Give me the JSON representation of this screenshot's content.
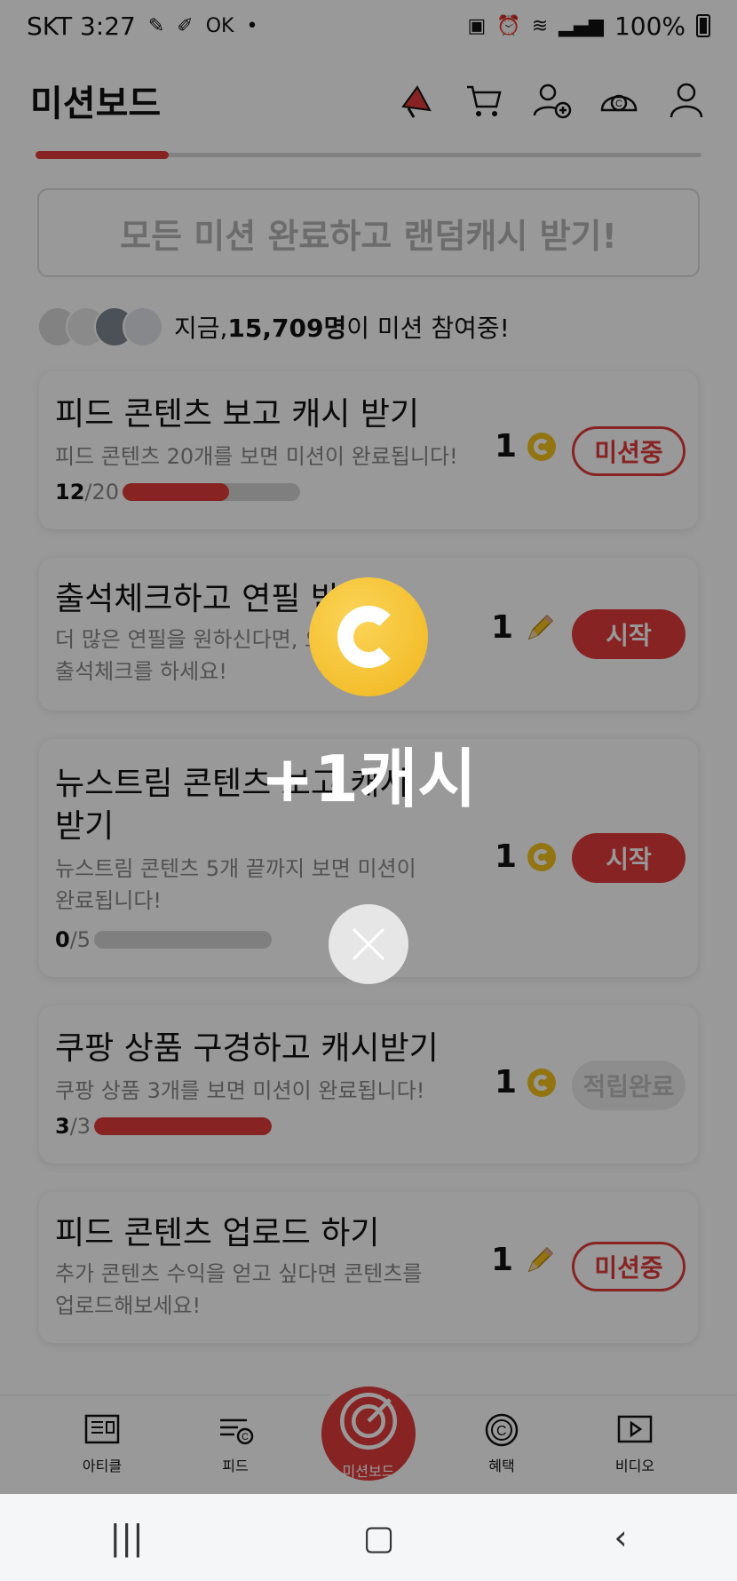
{
  "status_bar": {
    "carrier_time": "SKT 3:27",
    "ok_badge": "OK",
    "dot": "•",
    "battery_text": "100%"
  },
  "header": {
    "title": "미션보드"
  },
  "banner": {
    "text": "모든 미션 완료하고 랜덤캐시 받기!"
  },
  "participants": {
    "prefix": "지금, ",
    "count": "15,709명",
    "suffix": "이 미션 참여중!"
  },
  "missions": [
    {
      "title": "피드 콘텐츠 보고 캐시 받기",
      "desc_lines": [
        "피드 콘텐츠 20개를 보면 미션이 완료됩니다!"
      ],
      "progress_current": "12",
      "progress_total": "/20",
      "progress_fraction": 0.6,
      "reward": "1",
      "reward_icon": "coin-icon",
      "button": "미션중",
      "button_style": "outline"
    },
    {
      "title": "출석체크하고 연필 받기",
      "desc_lines": [
        "더 많은 연필을 원하신다면, 오늘도",
        "출석체크를 하세요!"
      ],
      "reward": "1",
      "reward_icon": "pencil-icon",
      "button": "시작",
      "button_style": "solid"
    },
    {
      "title_lines": [
        "뉴스트림 콘텐츠 보고 캐시",
        "받기"
      ],
      "desc_lines": [
        "뉴스트림 콘텐츠 5개 끝까지 보면 미션이",
        "완료됩니다!"
      ],
      "progress_current": "0",
      "progress_total": "/5",
      "progress_fraction": 0,
      "reward": "1",
      "reward_icon": "coin-icon",
      "button": "시작",
      "button_style": "solid"
    },
    {
      "title": "쿠팡 상품 구경하고 캐시받기",
      "desc_lines": [
        "쿠팡 상품 3개를 보면 미션이 완료됩니다!"
      ],
      "progress_current": "3",
      "progress_total": "/3",
      "progress_fraction": 1,
      "reward": "1",
      "reward_icon": "coin-icon",
      "button": "적립완료",
      "button_style": "done"
    },
    {
      "title": "피드 콘텐츠 업로드 하기",
      "desc_lines": [
        "추가 콘텐츠 수익을 얻고 싶다면 콘텐츠를",
        "업로드해보세요!"
      ],
      "reward": "1",
      "reward_icon": "pencil-icon",
      "button": "미션중",
      "button_style": "outline"
    }
  ],
  "bottom_nav": {
    "items": [
      "아티클",
      "피드",
      "미션보드",
      "혜택",
      "비디오"
    ]
  },
  "android_nav": {
    "recent": "|||",
    "home": "▢",
    "back": "‹"
  },
  "popup": {
    "reward_text": "+1캐시"
  },
  "colors": {
    "accent": "#e23b3b",
    "coin": "#f4c21c"
  }
}
